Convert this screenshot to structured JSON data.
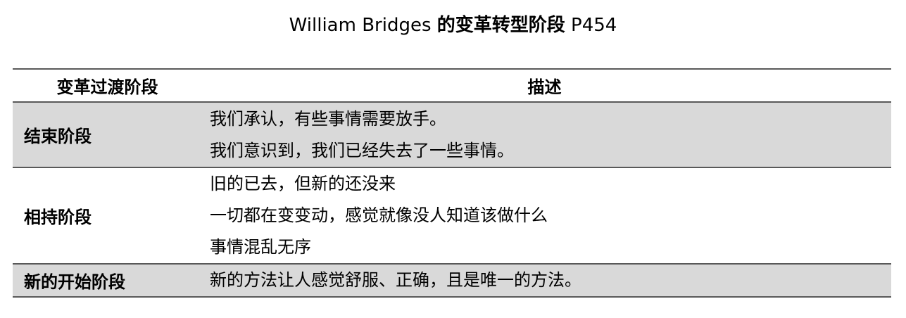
{
  "title": {
    "text_en": "William Bridges ",
    "text_cn": "的变革转型阶段",
    "page": " P454"
  },
  "table": {
    "headers": [
      "变革过渡阶段",
      "描述"
    ],
    "rows": [
      {
        "stage": "结束阶段",
        "lines": [
          "我们承认，有些事情需要放手。",
          "我们意识到，我们已经失去了一些事情。"
        ]
      },
      {
        "stage": "相持阶段",
        "lines": [
          "旧的已去，但新的还没来",
          "一切都在变变动，感觉就像没人知道该做什么",
          "事情混乱无序"
        ]
      },
      {
        "stage": "新的开始阶段",
        "lines": [
          "新的方法让人感觉舒服、正确，且是唯一的方法。"
        ]
      }
    ]
  },
  "colors": {
    "shaded_row": "#d9d9d9",
    "rule": "#595959"
  }
}
